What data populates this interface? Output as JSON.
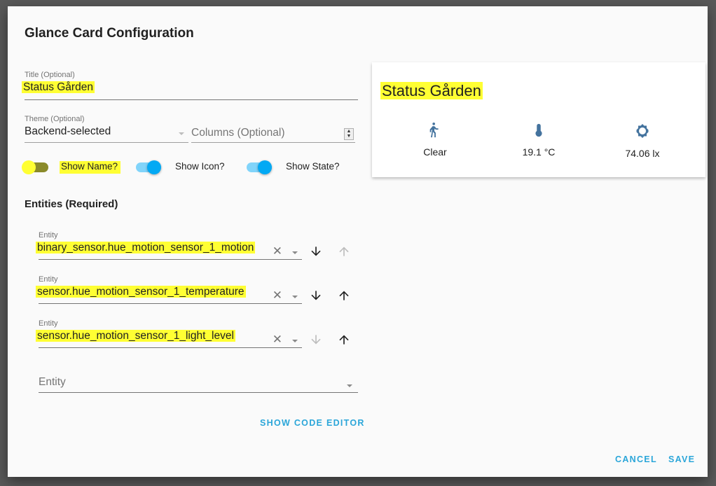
{
  "dialog": {
    "title": "Glance Card Configuration"
  },
  "form": {
    "title_field": {
      "label": "Title (Optional)",
      "value": "Status Gården"
    },
    "theme_field": {
      "label": "Theme (Optional)",
      "value": "Backend-selected"
    },
    "columns_field": {
      "placeholder": "Columns (Optional)",
      "value": ""
    },
    "toggles": [
      {
        "label": "Show Name?",
        "checked": false
      },
      {
        "label": "Show Icon?",
        "checked": true
      },
      {
        "label": "Show State?",
        "checked": true
      }
    ],
    "entities_heading": "Entities (Required)",
    "entities": [
      {
        "label": "Entity",
        "value": "binary_sensor.hue_motion_sensor_1_motion",
        "move_down_enabled": true,
        "move_up_enabled": false
      },
      {
        "label": "Entity",
        "value": "sensor.hue_motion_sensor_1_temperature",
        "move_down_enabled": true,
        "move_up_enabled": true
      },
      {
        "label": "Entity",
        "value": "sensor.hue_motion_sensor_1_light_level",
        "move_down_enabled": false,
        "move_up_enabled": true
      }
    ],
    "new_entity": {
      "placeholder": "Entity"
    },
    "show_code_editor_label": "Show Code Editor"
  },
  "preview": {
    "title": "Status Gården",
    "items": [
      {
        "icon": "motion-sensor-icon",
        "state": "Clear"
      },
      {
        "icon": "thermometer-icon",
        "state": "19.1 °C"
      },
      {
        "icon": "brightness-icon",
        "state": "74.06 lx"
      }
    ],
    "icon_color": "#44739e"
  },
  "actions": {
    "cancel_label": "Cancel",
    "save_label": "Save"
  },
  "colors": {
    "accent": "#03a9f4",
    "button_text": "#2ba6d9",
    "highlight": "#ffff33"
  }
}
